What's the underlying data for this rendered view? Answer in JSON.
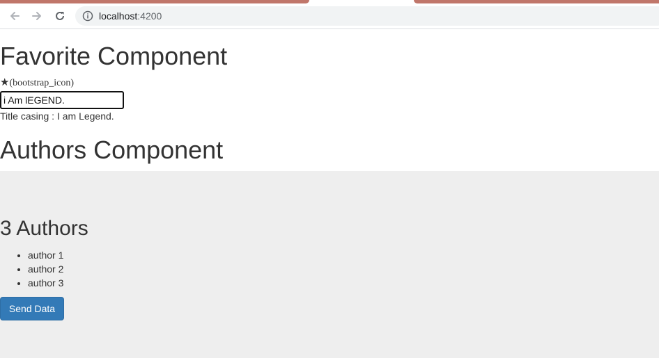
{
  "browser": {
    "url_host": "localhost",
    "url_port": ":4200",
    "back_icon": "arrow-left-icon",
    "forward_icon": "arrow-right-icon",
    "reload_icon": "reload-icon",
    "info_icon": "info-icon",
    "tab_color": "#c0766a"
  },
  "favorite": {
    "title": "Favorite Component",
    "star_glyph": "★",
    "icon_note": "(bootstrap_icon)",
    "input_value": "i Am lEGEND.",
    "casing_text": "Title casing : I am Legend."
  },
  "authors": {
    "title": "Authors Component",
    "count_text": "3 Authors",
    "items": [
      "author 1",
      "author 2",
      "author 3"
    ],
    "button_label": "Send Data",
    "panel_color": "#eeeeee",
    "button_color": "#337ab7"
  }
}
